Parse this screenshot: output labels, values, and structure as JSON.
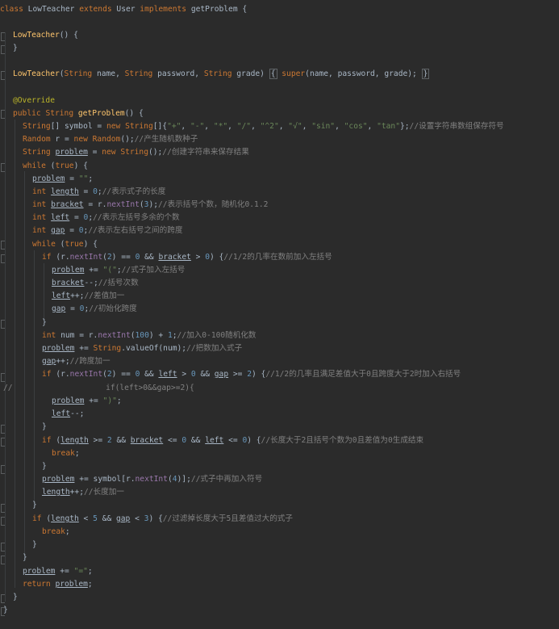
{
  "editor": {
    "lines": [
      "class LowTeacher extends User implements getProblem {",
      "",
      "LowTeacher() {",
      "}",
      "",
      "LowTeacher(String name, String password, String grade) { super(name, password, grade); }",
      "",
      "@Override",
      "public String getProblem() {",
      "String[] symbol = new String[]{\"+\", \"-\", \"*\", \"/\", \"^2\", \"√\", \"sin\", \"cos\", \"tan\"};//设置字符串数组保存符号",
      "Random r = new Random();//产生随机数种子",
      "String problem = new String();//创建字符串来保存结果",
      "while (true) {",
      "problem = \"\";",
      "int length = 0;//表示式子的长度",
      "int bracket = r.nextInt(3);//表示括号个数，随机化0.1.2",
      "int left = 0;//表示左括号多余的个数",
      "int gap = 0;//表示左右括号之间的跨度",
      "while (true) {",
      "if (r.nextInt(2) == 0 && bracket > 0) {//1/2的几率在数前加入左括号",
      "problem += \"(\";//式子加入左括号",
      "bracket--;//括号次数",
      "left++;//差值加一",
      "gap = 0;//初始化跨度",
      "}",
      "int num = r.nextInt(100) + 1;//加入0-100随机化数",
      "problem += String.valueOf(num);//把数加入式子",
      "gap++;//跨度加一",
      "if (r.nextInt(2) == 0 && left > 0 && gap >= 2) {//1/2的几率且满足差值大于0且跨度大于2时加入右括号",
      "//                    if(left>0&&gap>=2){",
      "problem += \")\";",
      "left--;",
      "}",
      "if (length >= 2 && bracket <= 0 && left <= 0) {//长度大于2且括号个数为0且差值为0生成结束",
      "break;",
      "}",
      "problem += symbol[r.nextInt(4)];//式子中再加入符号",
      "length++;//长度加一",
      "}",
      "if (length < 5 && gap < 3) {//过滤掉长度大于5且差值过大的式子",
      "break;",
      "}",
      "}",
      "problem += \"=\";",
      "return problem;",
      "}",
      "}"
    ]
  }
}
